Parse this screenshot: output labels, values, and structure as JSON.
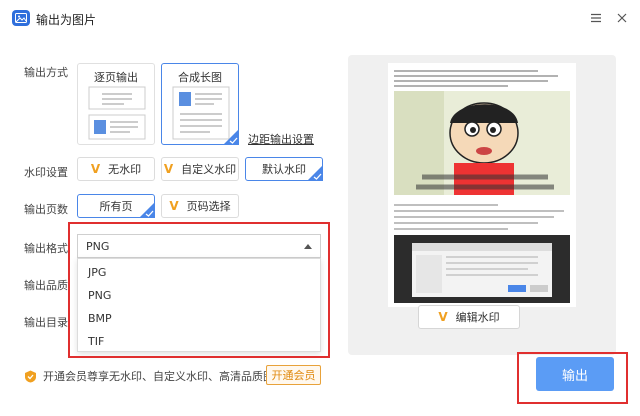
{
  "window": {
    "title": "输出为图片"
  },
  "labels": {
    "output_mode": "输出方式",
    "watermark": "水印设置",
    "pages": "输出页数",
    "format": "输出格式",
    "quality": "输出品质",
    "directory": "输出目录"
  },
  "output_mode": {
    "options": [
      "逐页输出",
      "合成长图"
    ],
    "selected": "合成长图",
    "margin_link": "边距输出设置"
  },
  "watermark": {
    "options": [
      "无水印",
      "自定义水印",
      "默认水印"
    ],
    "selected": "默认水印"
  },
  "pages": {
    "options": [
      "所有页",
      "页码选择"
    ],
    "selected": "所有页"
  },
  "format": {
    "selected": "PNG",
    "options": [
      "JPG",
      "PNG",
      "BMP",
      "TIF"
    ]
  },
  "vip": {
    "text": "开通会员尊享无水印、自定义水印、高清品质图片",
    "button": "开通会员"
  },
  "preview": {
    "edit_watermark": "编辑水印"
  },
  "export": {
    "label": "输出"
  },
  "colors": {
    "accent": "#4a86e8",
    "export_button": "#5b9cf5",
    "highlight": "#e02f2f",
    "vip": "#e8a23a"
  }
}
